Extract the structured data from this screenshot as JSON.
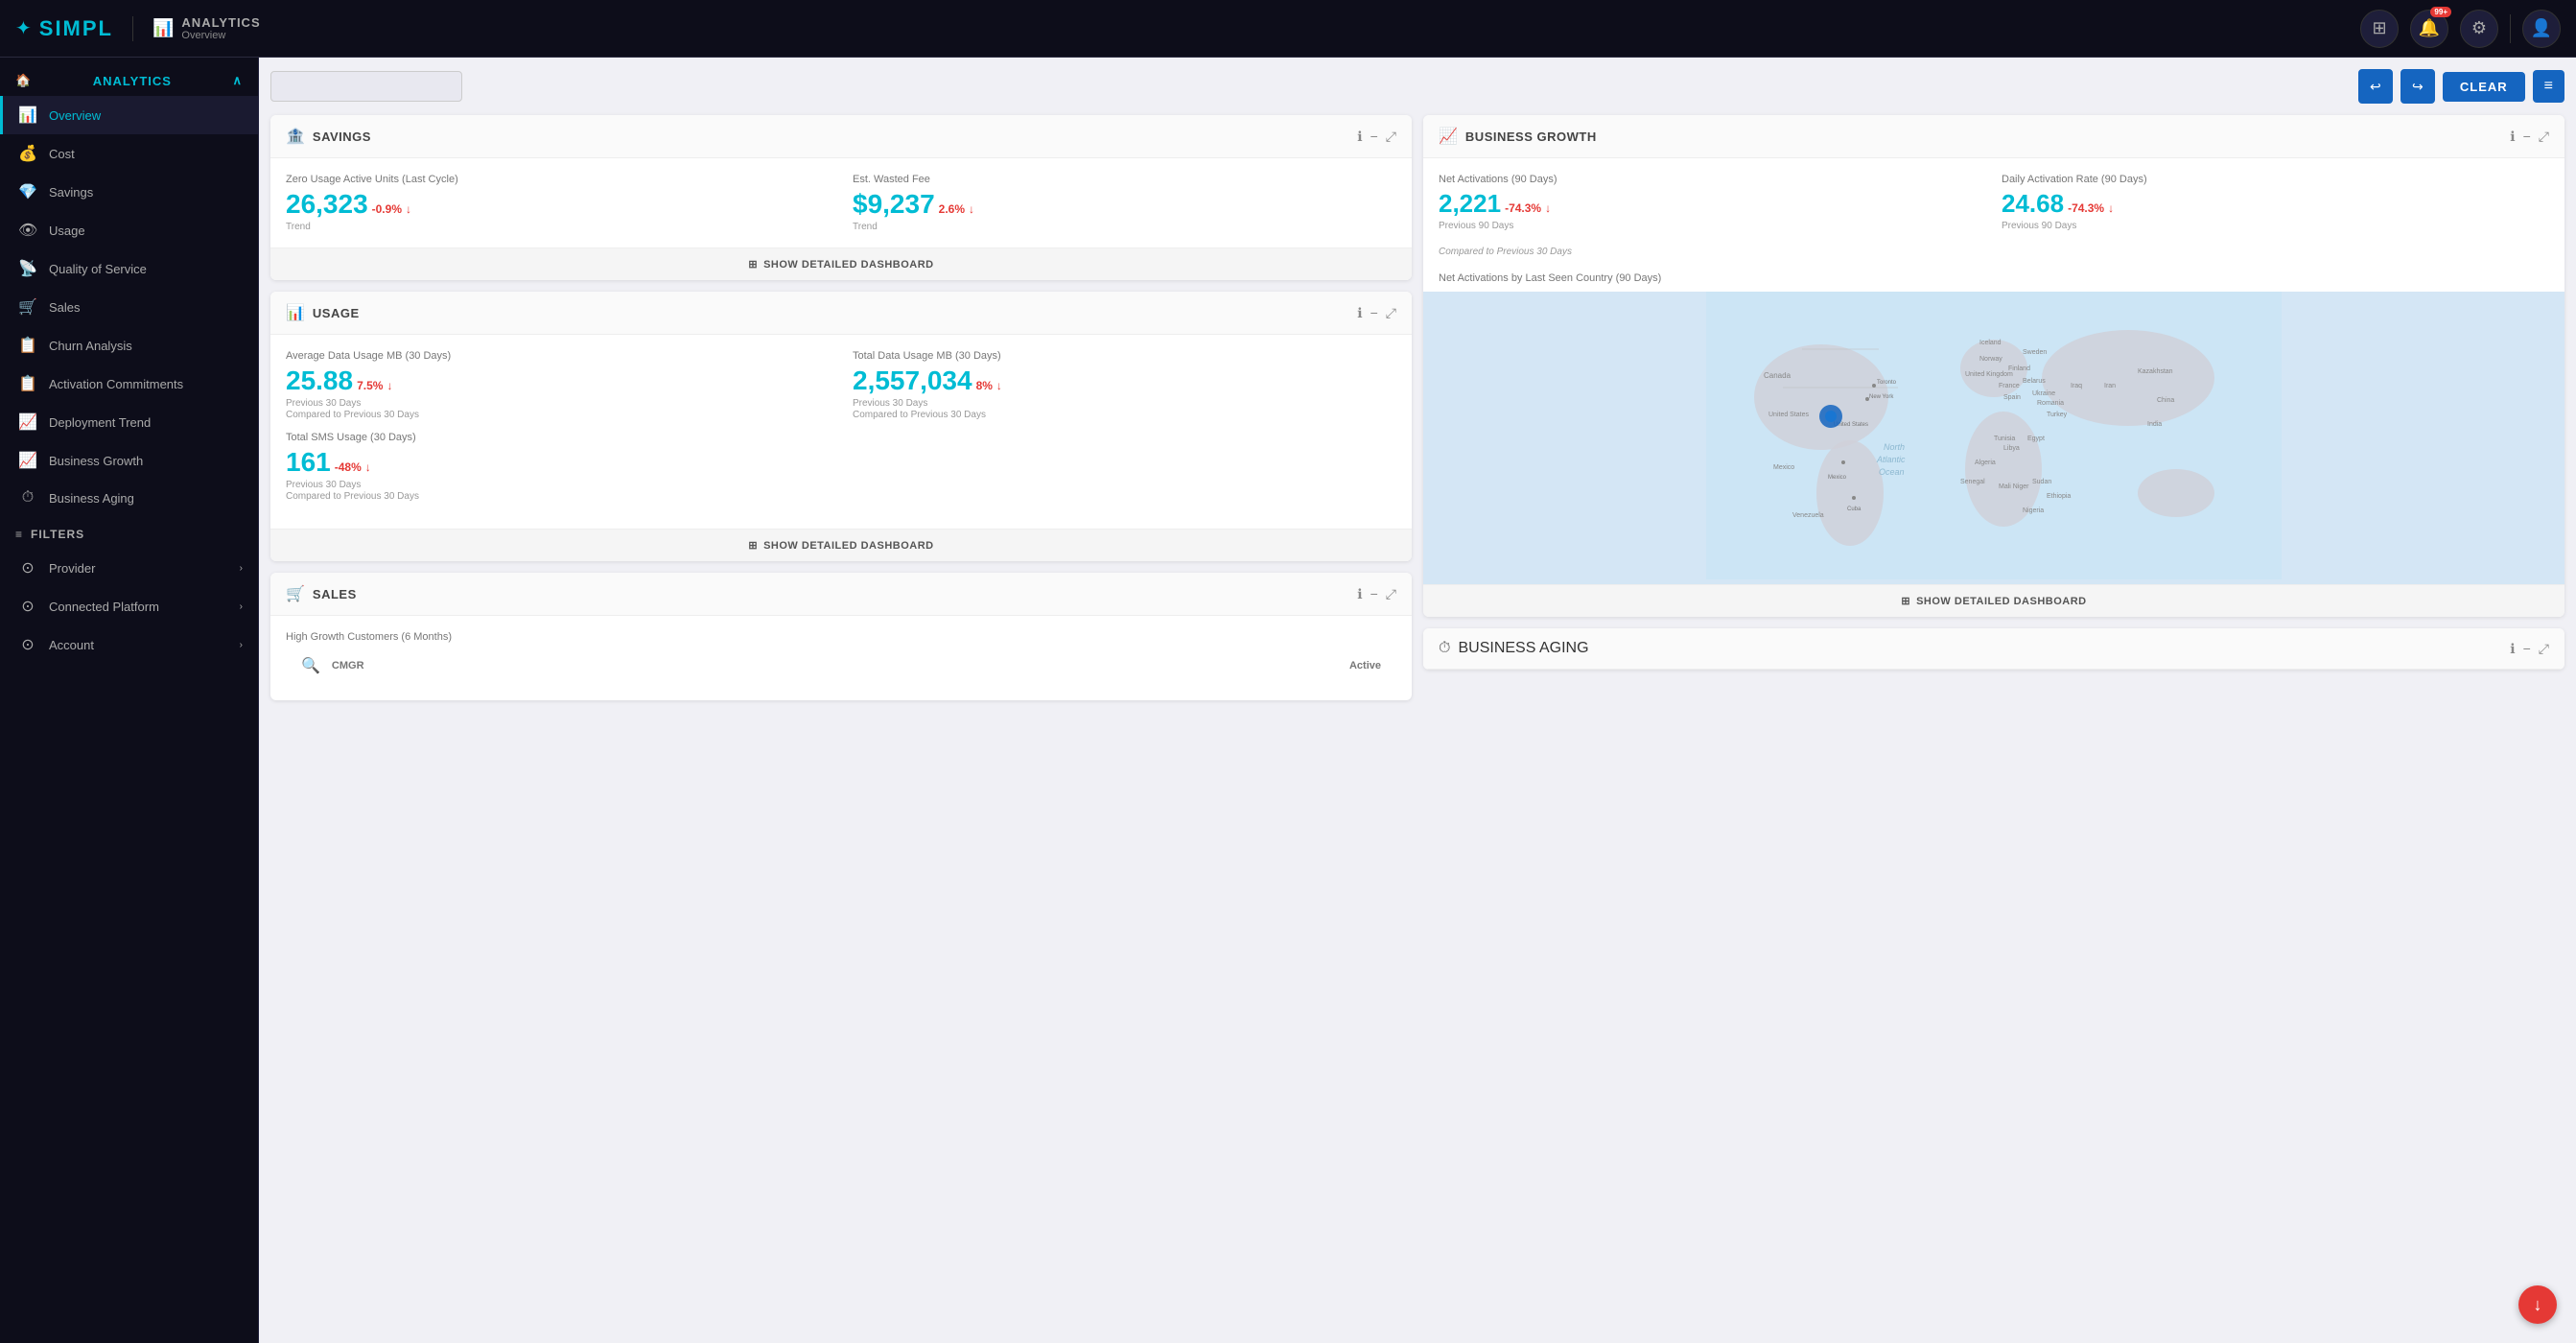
{
  "app": {
    "logo_text": "SIMPL",
    "nav_title": "ANALYTICS",
    "nav_subtitle": "Overview"
  },
  "nav_buttons": {
    "apps_icon": "⊞",
    "notifications_icon": "🔔",
    "notifications_badge": "99+",
    "settings_icon": "⚙",
    "profile_icon": "👤"
  },
  "toolbar": {
    "date_placeholder": "",
    "undo_icon": "↩",
    "redo_icon": "↪",
    "clear_label": "CLEAR",
    "menu_icon": "≡"
  },
  "sidebar": {
    "analytics_label": "ANALYTICS",
    "items": [
      {
        "id": "overview",
        "label": "Overview",
        "icon": "📊",
        "active": true
      },
      {
        "id": "cost",
        "label": "Cost",
        "icon": "💰",
        "active": false
      },
      {
        "id": "savings",
        "label": "Savings",
        "icon": "💎",
        "active": false
      },
      {
        "id": "usage",
        "label": "Usage",
        "icon": "👁",
        "active": false
      },
      {
        "id": "quality-of-service",
        "label": "Quality of Service",
        "icon": "📡",
        "active": false
      },
      {
        "id": "sales",
        "label": "Sales",
        "icon": "🛒",
        "active": false
      },
      {
        "id": "churn-analysis",
        "label": "Churn Analysis",
        "icon": "📋",
        "active": false
      },
      {
        "id": "activation-commitments",
        "label": "Activation Commitments",
        "icon": "📋",
        "active": false
      },
      {
        "id": "deployment-trend",
        "label": "Deployment Trend",
        "icon": "📈",
        "active": false
      },
      {
        "id": "business-growth",
        "label": "Business Growth",
        "icon": "📈",
        "active": false
      },
      {
        "id": "business-aging",
        "label": "Business Aging",
        "icon": "⏱",
        "active": false
      }
    ],
    "filters_label": "FILTERS",
    "filter_items": [
      {
        "id": "provider",
        "label": "Provider",
        "has_arrow": true
      },
      {
        "id": "connected-platform",
        "label": "Connected Platform",
        "has_arrow": true
      },
      {
        "id": "account",
        "label": "Account",
        "has_arrow": true
      }
    ]
  },
  "savings_card": {
    "title": "SAVINGS",
    "info_icon": "ℹ",
    "minus_icon": "−",
    "expand_icon": "⤢",
    "zero_usage_label": "Zero Usage Active Units (Last Cycle)",
    "zero_usage_value": "26,323",
    "zero_usage_trend": "-0.9%",
    "zero_usage_trend_label": "Trend",
    "est_wasted_label": "Est. Wasted Fee",
    "est_wasted_value": "$9,237",
    "est_wasted_trend": "2.6%",
    "est_wasted_trend_label": "Trend",
    "show_dashboard_label": "SHOW DETAILED DASHBOARD"
  },
  "usage_card": {
    "title": "USAGE",
    "info_icon": "ℹ",
    "minus_icon": "−",
    "expand_icon": "⤢",
    "avg_data_label": "Average Data Usage MB (30 Days)",
    "avg_data_value": "25.88",
    "avg_data_trend": "7.5%",
    "avg_data_trend_sub": "Previous 30 Days",
    "avg_data_compared": "Compared to Previous 30 Days",
    "total_data_label": "Total Data Usage MB (30 Days)",
    "total_data_value": "2,557,034",
    "total_data_trend": "8%",
    "total_data_trend_sub": "Previous 30 Days",
    "total_data_compared": "Compared to Previous 30 Days",
    "total_sms_label": "Total SMS Usage (30 Days)",
    "total_sms_value": "161",
    "total_sms_trend": "-48%",
    "total_sms_trend_sub": "Previous 30 Days",
    "total_sms_compared": "Compared to Previous 30 Days",
    "show_dashboard_label": "SHOW DETAILED DASHBOARD"
  },
  "sales_card": {
    "title": "SALES",
    "info_icon": "ℹ",
    "minus_icon": "−",
    "expand_icon": "⤢",
    "high_growth_label": "High Growth Customers (6 Months)",
    "col_cmgr": "CMGR",
    "col_active": "Active"
  },
  "business_growth_card": {
    "title": "BUSINESS GROWTH",
    "info_icon": "ℹ",
    "minus_icon": "−",
    "expand_icon": "⤢",
    "net_activations_label": "Net Activations (90 Days)",
    "net_activations_value": "2,221",
    "net_activations_trend": "-74.3%",
    "net_activations_trend_sub": "Previous 90 Days",
    "daily_rate_label": "Daily Activation Rate (90 Days)",
    "daily_rate_value": "24.68",
    "daily_rate_trend": "-74.3%",
    "daily_rate_trend_sub": "Previous 90 Days",
    "compared_label": "Compared to Previous 30 Days",
    "map_section_label": "Net Activations by Last Seen Country (90 Days)",
    "show_dashboard_label": "SHOW DETAILED DASHBOARD"
  },
  "business_aging_card": {
    "title": "BUSINESS AGING",
    "info_icon": "ℹ",
    "minus_icon": "−",
    "expand_icon": "⤢"
  },
  "icons": {
    "savings": "🏦",
    "usage": "📊",
    "sales": "🛒",
    "business_growth": "📈",
    "business_aging": "⏱",
    "dashboard": "⊞",
    "scroll_down": "↓"
  }
}
